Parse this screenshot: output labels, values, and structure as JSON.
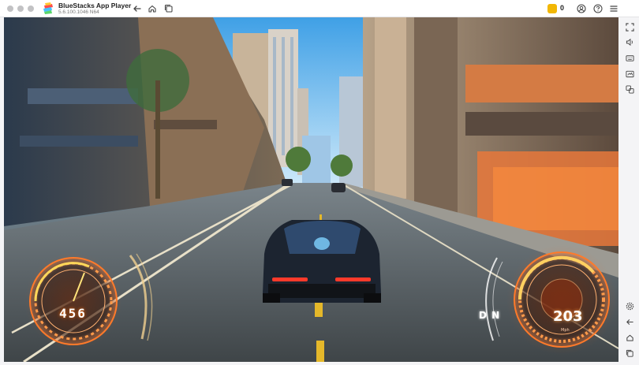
{
  "app": {
    "title": "BlueStacks App Player",
    "version": "5.6.100.1046 N64"
  },
  "toolbar": {
    "back_icon": "arrow-left-icon",
    "home_icon": "home-icon",
    "multi_instance_icon": "multi-instance-icon",
    "coin_icon": "game-coin-icon",
    "coin_count": "0",
    "account_icon": "account-icon",
    "help_icon": "help-icon",
    "menu_icon": "hamburger-menu-icon"
  },
  "game": {
    "left_gauge_value": "456",
    "gear_display": "D N",
    "speed_value": "203",
    "speed_unit": "Mph",
    "hud_color": "#ff6a1a"
  },
  "sidebar": {
    "items": [
      {
        "icon": "fullscreen-icon"
      },
      {
        "icon": "volume-icon"
      },
      {
        "icon": "keyboard-controls-icon"
      },
      {
        "icon": "screenshot-icon"
      },
      {
        "icon": "multi-window-icon"
      },
      {
        "icon": "settings-icon"
      },
      {
        "icon": "back-icon"
      },
      {
        "icon": "home-icon"
      },
      {
        "icon": "recent-apps-icon"
      }
    ]
  },
  "colors": {
    "accent_coin": "#f2b705",
    "titlebar_bg": "#ffffff",
    "sidebar_bg": "#f4f4f6"
  }
}
